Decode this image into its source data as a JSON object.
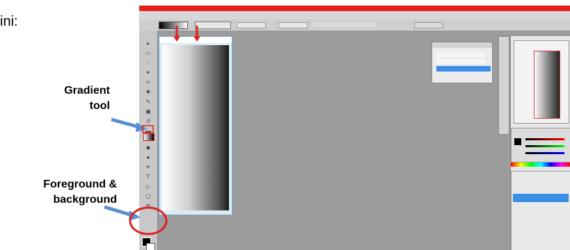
{
  "annotations": {
    "top_left_text": "ini:",
    "gradient_label_line1": "Gradient",
    "gradient_label_line2": "tool",
    "fg_label_line1": "Foreground &",
    "fg_label_line2": "background"
  },
  "colors": {
    "arrow": "#5b8fd1",
    "highlight": "#e02020",
    "canvas_bg": "#9c9c9c",
    "selection": "#3a8ee6"
  },
  "icons": {
    "gradient_tool": "gradient-tool-icon",
    "foreground_swatch": "foreground-color-swatch",
    "background_swatch": "background-color-swatch"
  }
}
